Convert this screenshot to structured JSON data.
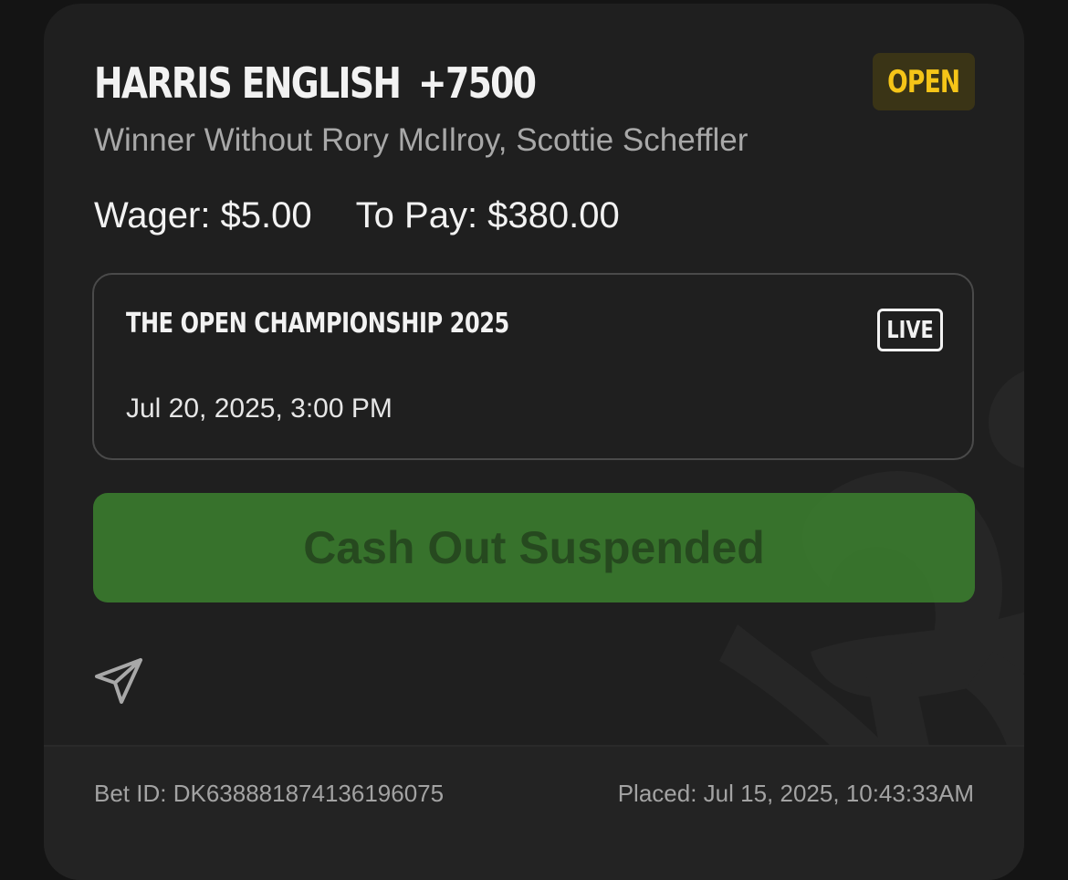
{
  "bet": {
    "selection": "HARRIS ENGLISH",
    "odds": "+7500",
    "status": "OPEN",
    "market": "Winner Without Rory McIlroy, Scottie Scheffler",
    "wager_text": "Wager: $5.00",
    "to_pay_text": "To Pay: $380.00"
  },
  "event": {
    "name": "THE OPEN CHAMPIONSHIP 2025",
    "live_badge": "LIVE",
    "datetime": "Jul 20, 2025, 3:00 PM"
  },
  "actions": {
    "cashout_label": "Cash Out Suspended",
    "share_icon": "send-icon"
  },
  "footer": {
    "bet_id": "Bet ID: DK638881874136196075",
    "placed": "Placed: Jul 15, 2025, 10:43:33AM"
  },
  "colors": {
    "background": "#141414",
    "card": "#1f1f1f",
    "status_text": "#f5c518",
    "status_bg": "#3a3416",
    "cashout_bg": "#3a7a2e",
    "cashout_text": "#274d20"
  }
}
